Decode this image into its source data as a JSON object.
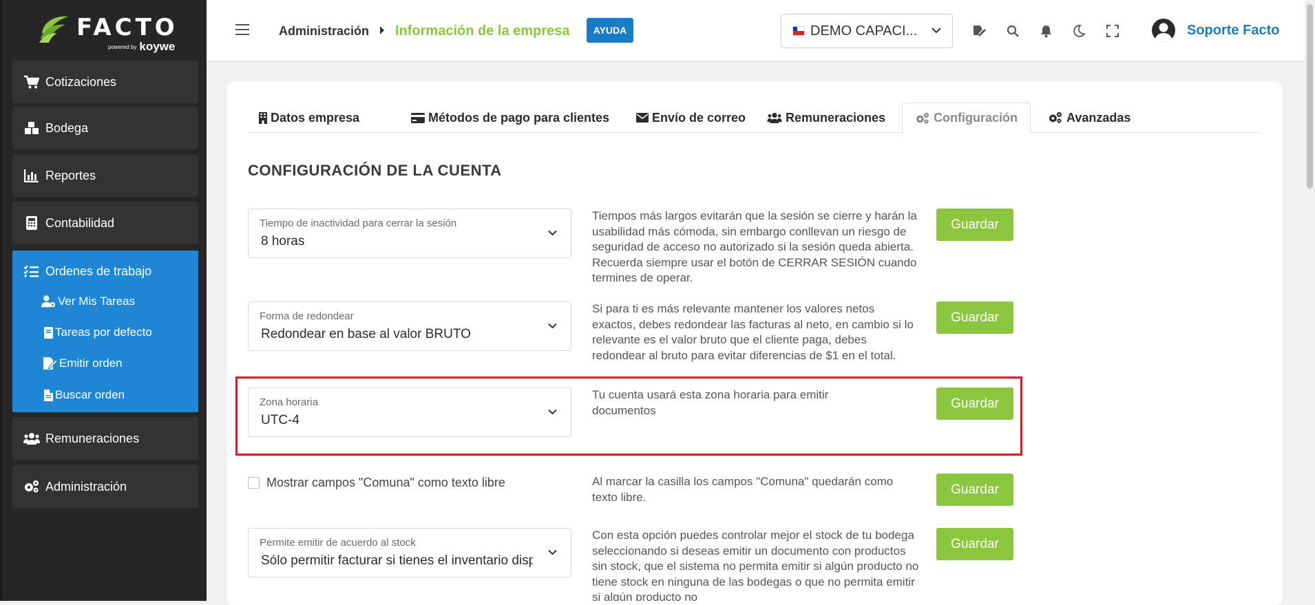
{
  "brand": {
    "name": "FACTO",
    "powered": "powered by",
    "partner": "koywe"
  },
  "sidebar": {
    "items": [
      {
        "label": "Cotizaciones",
        "icon": "cart-icon"
      },
      {
        "label": "Bodega",
        "icon": "boxes-icon"
      },
      {
        "label": "Reportes",
        "icon": "bar-chart-icon"
      },
      {
        "label": "Contabilidad",
        "icon": "calculator-icon"
      },
      {
        "label": "Ordenes de trabajo",
        "icon": "task-list-icon"
      },
      {
        "label": "Remuneraciones",
        "icon": "users-icon"
      },
      {
        "label": "Administración",
        "icon": "gears-icon"
      }
    ],
    "subitems": [
      {
        "label": "Ver Mis Tareas",
        "icon": "user-gear-icon"
      },
      {
        "label": "Tareas por defecto",
        "icon": "book-icon"
      },
      {
        "label": "Emitir orden",
        "icon": "file-signature-icon"
      },
      {
        "label": "Buscar orden",
        "icon": "file-icon"
      }
    ]
  },
  "header": {
    "breadcrumb_root": "Administración",
    "breadcrumb_current": "Información de la empresa",
    "help_label": "AYUDA",
    "company": "DEMO CAPACI...",
    "user_name": "Soporte Facto"
  },
  "tabs": [
    {
      "label": "Datos empresa",
      "icon": "building-icon"
    },
    {
      "label": "Métodos de pago para clientes",
      "icon": "credit-card-icon"
    },
    {
      "label": "Envío de correo",
      "icon": "envelope-icon"
    },
    {
      "label": "Remuneraciones",
      "icon": "users-icon"
    },
    {
      "label": "Configuración",
      "icon": "gears-icon",
      "active": true
    },
    {
      "label": "Avanzadas",
      "icon": "gears-icon"
    }
  ],
  "main": {
    "title": "CONFIGURACIÓN DE LA CUENTA",
    "settings": [
      {
        "label": "Tiempo de inactividad para cerrar la sesión",
        "value": "8 horas",
        "description": "Tiempos más largos evitarán que la sesión se cierre y harán la usabilidad más cómoda, sin embargo conllevan un riesgo de seguridad de acceso no autorizado si la sesión queda abierta. Recuerda siempre usar el botón de CERRAR SESIÓN cuando termines de operar.",
        "button": "Guardar"
      },
      {
        "label": "Forma de redondear",
        "value": "Redondear en base al valor BRUTO",
        "description": "Si para ti es más relevante mantener los valores netos exactos, debes redondear las facturas al neto, en cambio si lo relevante es el valor bruto que el cliente paga, debes redondear al bruto para evitar diferencias de $1 en el total.",
        "button": "Guardar"
      },
      {
        "label": "Zona horaria",
        "value": "UTC-4",
        "description": "Tu cuenta usará esta zona horaria para emitir documentos",
        "button": "Guardar"
      },
      {
        "checkbox_label": "Mostrar campos \"Comuna\" como texto libre",
        "checked": false,
        "description": "Al marcar la casilla los campos \"Comuna\" quedarán como texto libre.",
        "button": "Guardar"
      },
      {
        "label": "Permite emitir de acuerdo al stock",
        "value": "Sólo permitir facturar si tienes el inventario disponible",
        "description": "Con esta opción puedes controlar mejor el stock de tu bodega seleccionando si deseas emitir un documento con productos sin stock, que el sistema no permita emitir si algún producto no tiene stock en ninguna de las bodegas o que no permita emitir si algún producto no",
        "button": "Guardar"
      }
    ]
  },
  "colors": {
    "accent_green": "#8cc63f",
    "accent_blue": "#1a7bc7",
    "sidebar_bg": "#262626",
    "highlight": "#e0141e"
  }
}
